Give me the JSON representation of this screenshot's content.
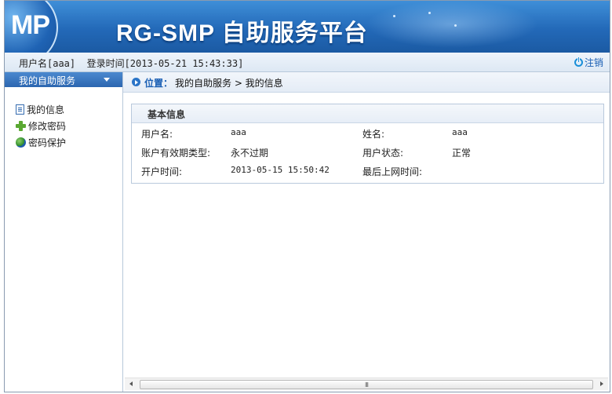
{
  "banner": {
    "logo_text": "MP",
    "title": "RG-SMP 自助服务平台"
  },
  "infobar": {
    "user_text": "用户名[aaa]  登录时间[2013-05-21 15:43:33]",
    "logout_label": "注销"
  },
  "sidebar": {
    "header": "我的自助服务",
    "items": [
      {
        "label": "我的信息",
        "icon": "document-icon"
      },
      {
        "label": "修改密码",
        "icon": "plus-icon"
      },
      {
        "label": "密码保护",
        "icon": "globe-icon"
      }
    ]
  },
  "breadcrumb": {
    "label": "位置：",
    "path": "我的自助服务 > 我的信息"
  },
  "panel": {
    "title": "基本信息",
    "rows": [
      {
        "k1": "用户名:",
        "v1": "aaa",
        "k2": "姓名:",
        "v2": "aaa"
      },
      {
        "k1": "账户有效期类型:",
        "v1": "永不过期",
        "k2": "用户状态:",
        "v2": "正常"
      },
      {
        "k1": "开户时间:",
        "v1": "2013-05-15 15:50:42",
        "k2": "最后上网时间:",
        "v2": ""
      }
    ]
  },
  "scrollbar": {
    "grip": "III"
  },
  "colors": {
    "banner": "#2369b8",
    "accent": "#1a5fb4",
    "sidebar_header": "#2c66b0"
  }
}
